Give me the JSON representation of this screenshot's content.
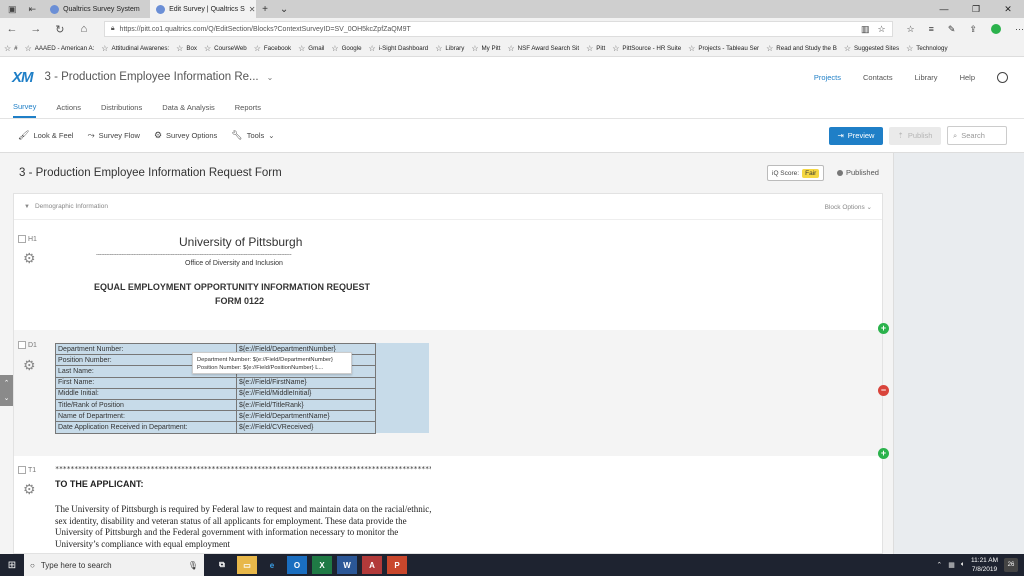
{
  "browser": {
    "tabs": [
      {
        "label": "Qualtrics Survey System",
        "active": false
      },
      {
        "label": "Edit Survey | Qualtrics S",
        "active": true
      }
    ],
    "url": "https://pitt.co1.qualtrics.com/Q/EditSection/Blocks?ContextSurveyID=SV_0OH5kcZpfZaQM9T",
    "favorites": [
      "#",
      "AAAED - American A:",
      "Attitudinal Awarenes:",
      "Box",
      "CourseWeb",
      "Facebook",
      "Gmail",
      "Google",
      "i-Sight Dashboard",
      "Library",
      "My Pitt",
      "NSF Award Search Sit",
      "Pitt",
      "PittSource - HR Suite",
      "Projects - Tableau Ser",
      "Read and Study the B",
      "Suggested Sites",
      "Technology"
    ]
  },
  "header": {
    "logo": "XM",
    "survey_title": "3 - Production Employee Information Re...",
    "nav": [
      "Projects",
      "Contacts",
      "Library",
      "Help"
    ]
  },
  "tabs": [
    "Survey",
    "Actions",
    "Distributions",
    "Data & Analysis",
    "Reports"
  ],
  "toolbar": {
    "look_feel": "Look & Feel",
    "survey_flow": "Survey Flow",
    "survey_options": "Survey Options",
    "tools": "Tools",
    "preview": "Preview",
    "publish": "Publish",
    "search_placeholder": "Search"
  },
  "editor": {
    "form_title": "3 - Production Employee Information Request Form",
    "iq_score_label": "iQ Score:",
    "iq_score_value": "Fair",
    "status": "Published",
    "block_name": "Demographic Information",
    "block_options": "Block Options"
  },
  "h1": {
    "label": "H1",
    "title": "University of Pittsburgh",
    "dashes": "-------------------------------------------------------------------------------------------------------------------",
    "office": "Office of Diversity and Inclusion",
    "heading_line1": "EQUAL EMPLOYMENT OPPORTUNITY INFORMATION REQUEST",
    "heading_line2": "FORM 0122"
  },
  "d1": {
    "label": "D1",
    "rows": [
      {
        "label": "Department Number:",
        "value": "${e://Field/DepartmentNumber}"
      },
      {
        "label": "Position Number:",
        "value": ""
      },
      {
        "label": "Last Name:",
        "value": ""
      },
      {
        "label": "First Name:",
        "value": "${e://Field/FirstName}"
      },
      {
        "label": "Middle Initial:",
        "value": "${e://Field/MiddleInitial}"
      },
      {
        "label": "Title/Rank of Position",
        "value": "${e://Field/TitleRank}"
      },
      {
        "label": "Name of Department:",
        "value": "${e://Field/DepartmentName}"
      },
      {
        "label": "Date Application Received in Department:",
        "value": "${e://Field/CVReceived}"
      }
    ],
    "tooltip_line1": "Department Number: ${e://Field/DepartmentNumber}",
    "tooltip_line2": "Position Number: ${e://Field/PositionNumber} L..."
  },
  "t1": {
    "label": "T1",
    "stars": "**********************************************************************************************************",
    "heading": "TO THE APPLICANT:",
    "paragraph": "The University of Pittsburgh is required by Federal law to request and maintain data on the racial/ethnic, sex identity, disability and veteran status of all applicants for employment. These data provide the University of Pittsburgh and the Federal government with information necessary to monitor the University’s compliance with equal employment"
  },
  "taskbar": {
    "search_placeholder": "Type here to search",
    "time": "11:21 AM",
    "date": "7/8/2019",
    "notifications": "26"
  }
}
